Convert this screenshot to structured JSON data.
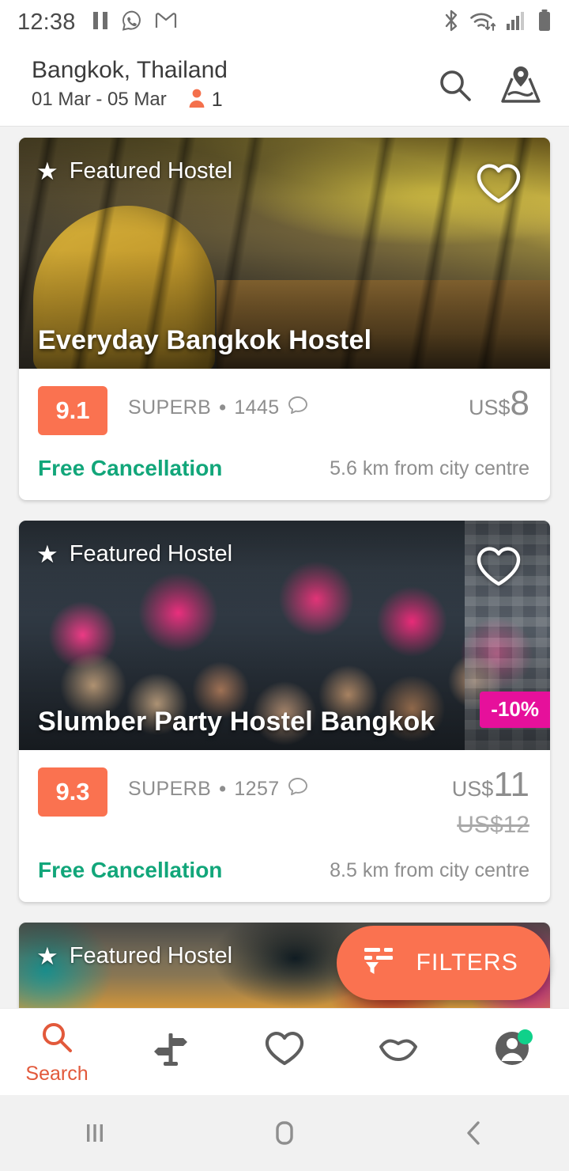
{
  "status_bar": {
    "clock": "12:38",
    "left_icons": [
      "pause-icon",
      "whatsapp-icon",
      "gmail-icon"
    ],
    "right_icons": [
      "bluetooth-icon",
      "wifi-icon",
      "cellular-signal-icon",
      "battery-icon"
    ]
  },
  "header": {
    "destination": "Bangkok, Thailand",
    "dates": "01 Mar - 05 Mar",
    "guests": "1",
    "search_icon": "search-icon",
    "map_icon": "map-pin-icon"
  },
  "cards": [
    {
      "featured_label": "Featured Hostel",
      "name": "Everyday Bangkok Hostel",
      "score": "9.1",
      "rating_word": "SUPERB",
      "separator": "•",
      "review_count": "1445",
      "review_icon": "comment-icon",
      "price_currency": "US$",
      "price_amount": "8",
      "price_old": "",
      "discount": "",
      "free_cancellation": "Free Cancellation",
      "distance": "5.6 km from city centre",
      "favorite_icon": "heart-outline-icon"
    },
    {
      "featured_label": "Featured Hostel",
      "name": "Slumber Party Hostel Bangkok",
      "score": "9.3",
      "rating_word": "SUPERB",
      "separator": "•",
      "review_count": "1257",
      "review_icon": "comment-icon",
      "price_currency": "US$",
      "price_amount": "11",
      "price_old": "US$12",
      "discount": "-10%",
      "free_cancellation": "Free Cancellation",
      "distance": "8.5 km from city centre",
      "favorite_icon": "heart-outline-icon"
    },
    {
      "featured_label": "Featured Hostel",
      "name": "",
      "score": "",
      "rating_word": "",
      "separator": "",
      "review_count": "",
      "review_icon": "",
      "price_currency": "",
      "price_amount": "",
      "price_old": "",
      "discount": "",
      "free_cancellation": "",
      "distance": "",
      "favorite_icon": ""
    }
  ],
  "filters_button": {
    "label": "FILTERS",
    "icon": "filter-icon"
  },
  "bottom_nav": [
    {
      "label": "Search",
      "icon": "search-icon",
      "active": true
    },
    {
      "label": "",
      "icon": "signpost-icon",
      "active": false
    },
    {
      "label": "",
      "icon": "heart-outline-icon",
      "active": false
    },
    {
      "label": "",
      "icon": "lips-chat-icon",
      "active": false
    },
    {
      "label": "",
      "icon": "profile-avatar-icon",
      "active": false
    }
  ],
  "system_nav": {
    "recents": "recents-icon",
    "home": "home-icon",
    "back": "back-icon"
  },
  "colors": {
    "accent_orange": "#FA7250",
    "discount_magenta": "#E6109B",
    "free_cancellation_green": "#12A67A",
    "notification_green": "#0FD18A",
    "page_background": "#F2F2F2",
    "muted_text": "#8E8E8E"
  }
}
